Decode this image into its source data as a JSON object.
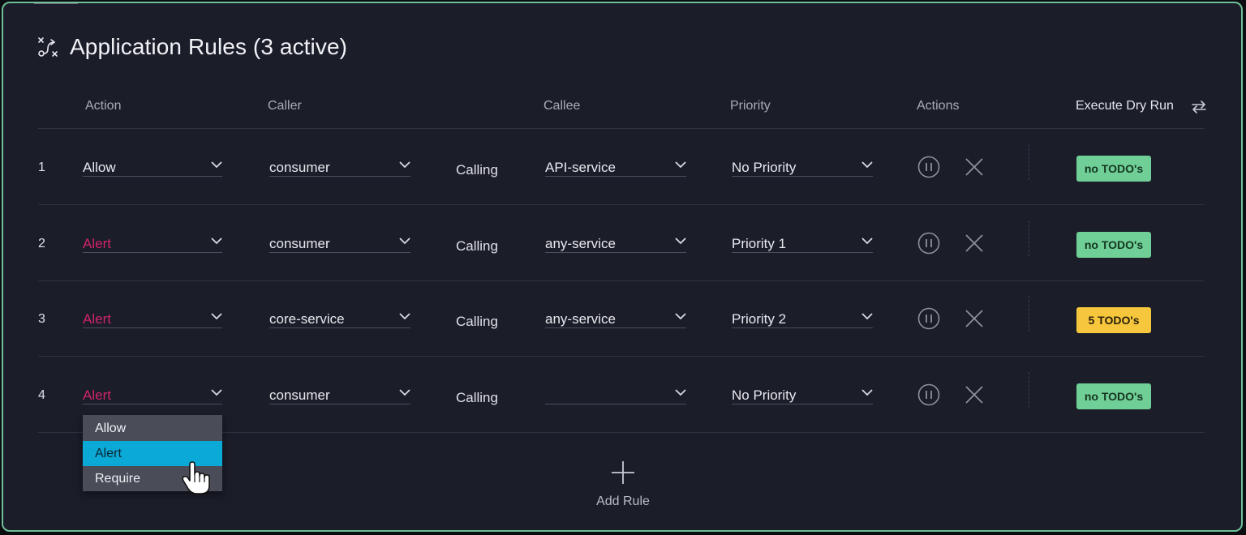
{
  "title": "Application Rules (3 active)",
  "headers": {
    "action": "Action",
    "caller": "Caller",
    "callee": "Callee",
    "priority": "Priority",
    "actions": "Actions",
    "dry_run": "Execute Dry Run"
  },
  "rows": [
    {
      "num": "1",
      "action": "Allow",
      "caller": "consumer",
      "calling": "Calling",
      "callee": "API-service",
      "priority": "No Priority",
      "todo": "no TODO's",
      "todo_status": "ok"
    },
    {
      "num": "2",
      "action": "Alert",
      "caller": "consumer",
      "calling": "Calling",
      "callee": "any-service",
      "priority": "Priority 1",
      "todo": "no TODO's",
      "todo_status": "ok"
    },
    {
      "num": "3",
      "action": "Alert",
      "caller": "core-service",
      "calling": "Calling",
      "callee": "any-service",
      "priority": "Priority 2",
      "todo": "5 TODO's",
      "todo_status": "warn"
    },
    {
      "num": "4",
      "action": "Alert",
      "caller": "consumer",
      "calling": "Calling",
      "callee": "",
      "priority": "No Priority",
      "todo": "no TODO's",
      "todo_status": "ok"
    }
  ],
  "action_dropdown": {
    "options": [
      "Allow",
      "Alert",
      "Require"
    ],
    "highlighted": "Alert"
  },
  "add_rule_label": "Add Rule",
  "colors": {
    "alert": "#d0236a",
    "ok_badge": "#6fcf97",
    "warn_badge": "#f6c63c",
    "dropdown_highlight": "#0aa9d6",
    "panel_border": "#6fbf9a"
  },
  "icons": {
    "title": "route-rules-icon",
    "dry_run_toggle": "swap-arrows-icon",
    "pause": "pause-circle-icon",
    "remove": "close-icon",
    "dropdown": "chevron-down-icon",
    "add": "plus-icon",
    "pointer": "hand-pointer-icon"
  }
}
